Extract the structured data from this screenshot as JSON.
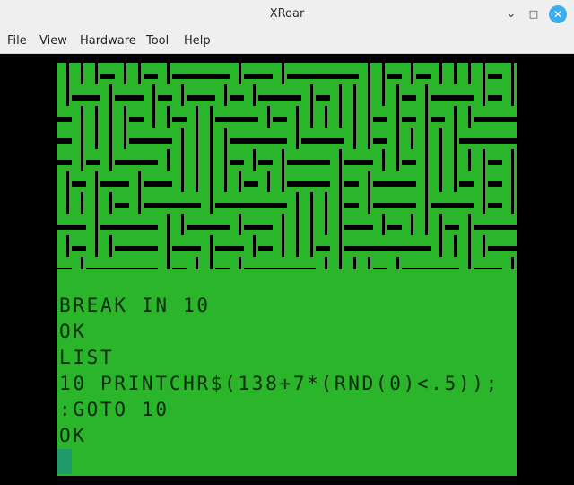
{
  "window": {
    "title": "XRoar"
  },
  "controls": {
    "minimize": "⌄",
    "maximize": "□",
    "close": "✕"
  },
  "menu": [
    {
      "label": "File"
    },
    {
      "label": "View"
    },
    {
      "label": "Hardware"
    },
    {
      "label": "Tool"
    },
    {
      "label": "Help"
    }
  ],
  "colors": {
    "screen_background": "#000000",
    "text_background_green": "#2ab52a",
    "text_ink": "#0a2a0a",
    "cursor": "#1f9b6a",
    "close_button": "#3daee9"
  },
  "console": {
    "lines": [
      "BREAK IN 10",
      "OK",
      "LIST",
      "10 PRINTCHR$(138+7*(RND(0)<.5));",
      ":GOTO 10",
      "OK"
    ]
  }
}
